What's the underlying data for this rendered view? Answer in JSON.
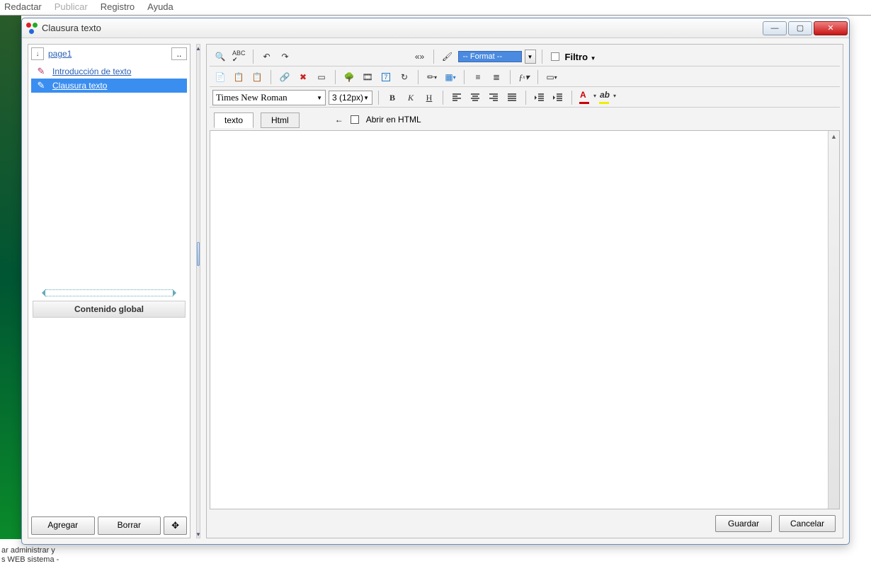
{
  "menu": {
    "redactar": "Redactar",
    "publicar": "Publicar",
    "registro": "Registro",
    "ayuda": "Ayuda"
  },
  "bgtext": {
    "l1": "ar administrar y",
    "l2": "s WEB sistema -"
  },
  "dialog": {
    "title": "Clausura texto",
    "page": "page1",
    "items": [
      {
        "label": "Introducción de texto"
      },
      {
        "label": "Clausura texto"
      }
    ],
    "global_header": "Contenido global",
    "btn_add": "Agregar",
    "btn_del": "Borrar",
    "footer_save": "Guardar",
    "footer_cancel": "Cancelar"
  },
  "toolbar": {
    "format_label": "-- Format --",
    "filtro": "Filtro",
    "font": "Times New Roman",
    "size": "3 (12px)",
    "tab_texto": "texto",
    "tab_html": "Html",
    "open_html": "Abrir en HTML",
    "nav": "«»",
    "arrow_back": "←"
  }
}
